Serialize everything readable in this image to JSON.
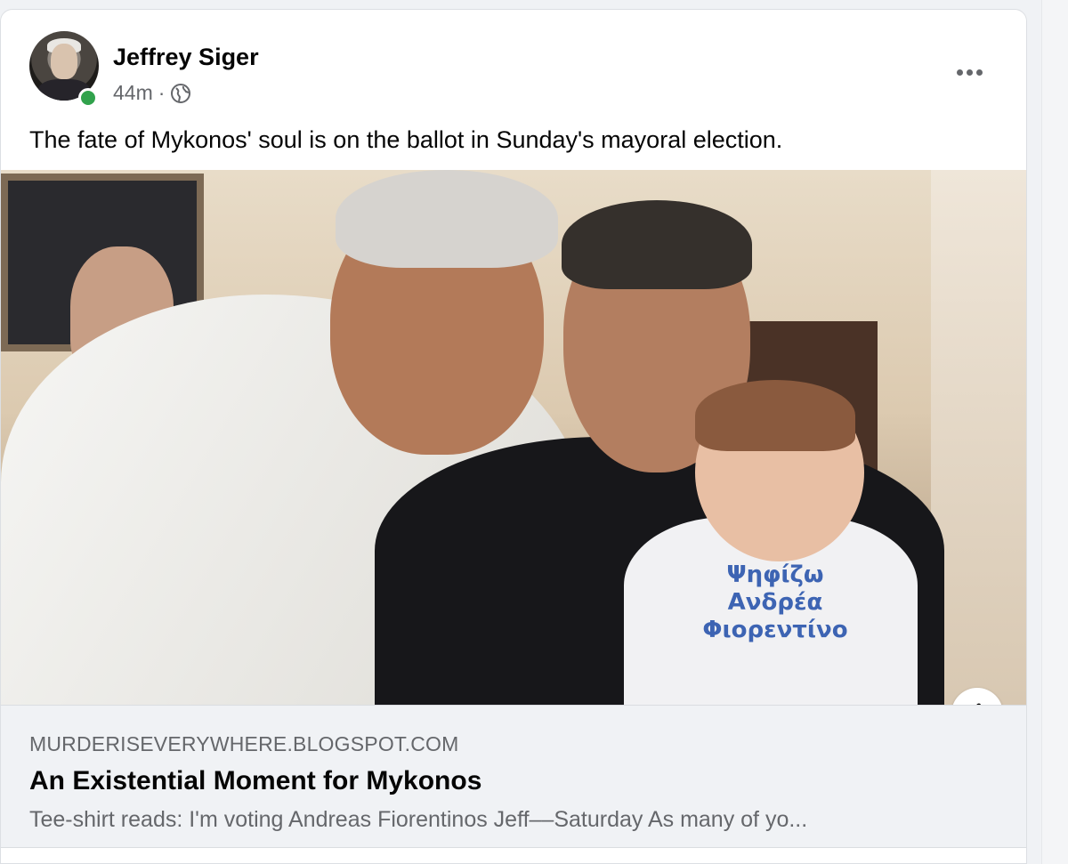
{
  "post": {
    "author": "Jeffrey Siger",
    "time": "44m",
    "separator": "·",
    "privacy_icon": "globe-icon",
    "text": "The fate of Mykonos' soul is on the ballot in Sunday's mayoral election.",
    "more_icon": "more-options-icon",
    "online_color": "#31a24c"
  },
  "photo": {
    "shirt_text_line1": "Ψηφίζω",
    "shirt_text_line2": "Ανδρέα",
    "shirt_text_line3": "Φιορεντίνο",
    "info_label": "i"
  },
  "link": {
    "domain": "MURDERISEVERYWHERE.BLOGSPOT.COM",
    "title": "An Existential Moment for Mykonos",
    "description": "Tee-shirt reads: I'm voting Andreas Fiorentinos Jeff––Saturday As many of yo..."
  }
}
